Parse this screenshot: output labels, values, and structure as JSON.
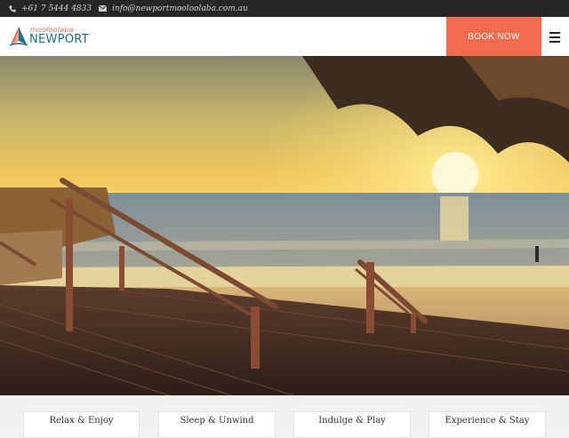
{
  "topbar": {
    "phone": "+61 7 5444 4833",
    "email": "info@newportmooloolaba.com.au",
    "phone_icon": "phone-icon",
    "email_icon": "envelope-icon"
  },
  "header": {
    "logo_small": "mooloolaba",
    "logo_big": "NEWPORT",
    "book_label": "BOOK NOW",
    "menu_icon": "hamburger-menu-icon"
  },
  "cards": [
    {
      "label": "Relax & Enjoy"
    },
    {
      "label": "Sleep & Unwind"
    },
    {
      "label": "Indulge & Play"
    },
    {
      "label": "Experience & Stay"
    }
  ],
  "colors": {
    "accent": "#f26b4f",
    "brand_blue": "#1c6f8c",
    "topbar_bg": "#262626"
  }
}
